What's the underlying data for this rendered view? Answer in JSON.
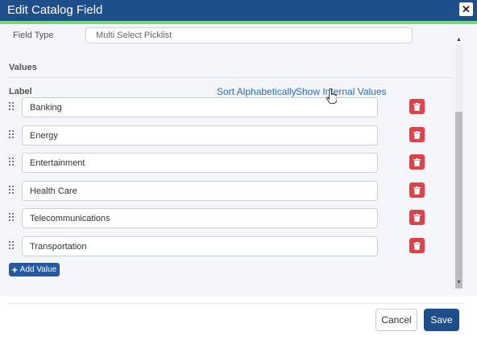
{
  "window": {
    "title": "Edit Catalog Field",
    "close_label": "✕"
  },
  "previous_field": {
    "label": "Field Type",
    "value": "Multi Select Picklist"
  },
  "values_section": {
    "title": "Values",
    "label_header": "Label",
    "sort_link": "Sort Alphabetically",
    "internal_link": "Show Internal Values",
    "items": [
      {
        "value": "Banking"
      },
      {
        "value": "Energy"
      },
      {
        "value": "Entertainment"
      },
      {
        "value": "Health Care"
      },
      {
        "value": "Telecommunications"
      },
      {
        "value": "Transportation"
      }
    ],
    "add_button": "Add Value",
    "add_icon": "+"
  },
  "footer": {
    "cancel": "Cancel",
    "save": "Save"
  },
  "icons": {
    "drag": "drag-handle-icon",
    "delete": "trash-icon",
    "close": "close-icon"
  },
  "colors": {
    "header": "#1f4f8a",
    "accent": "#7bd37a",
    "link": "#2f6db5",
    "delete": "#d9454a",
    "primary": "#245aa3"
  }
}
